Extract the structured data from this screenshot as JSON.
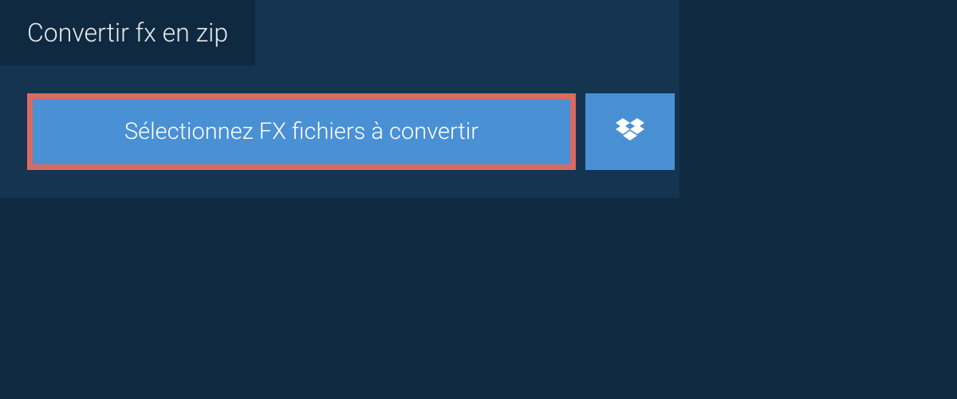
{
  "tab": {
    "title": "Convertir fx en zip"
  },
  "buttons": {
    "select_label": "Sélectionnez FX fichiers à convertir"
  },
  "colors": {
    "background_dark": "#0f2940",
    "panel": "#153450",
    "button_blue": "#4990d5",
    "highlight_border": "#d86a62"
  }
}
